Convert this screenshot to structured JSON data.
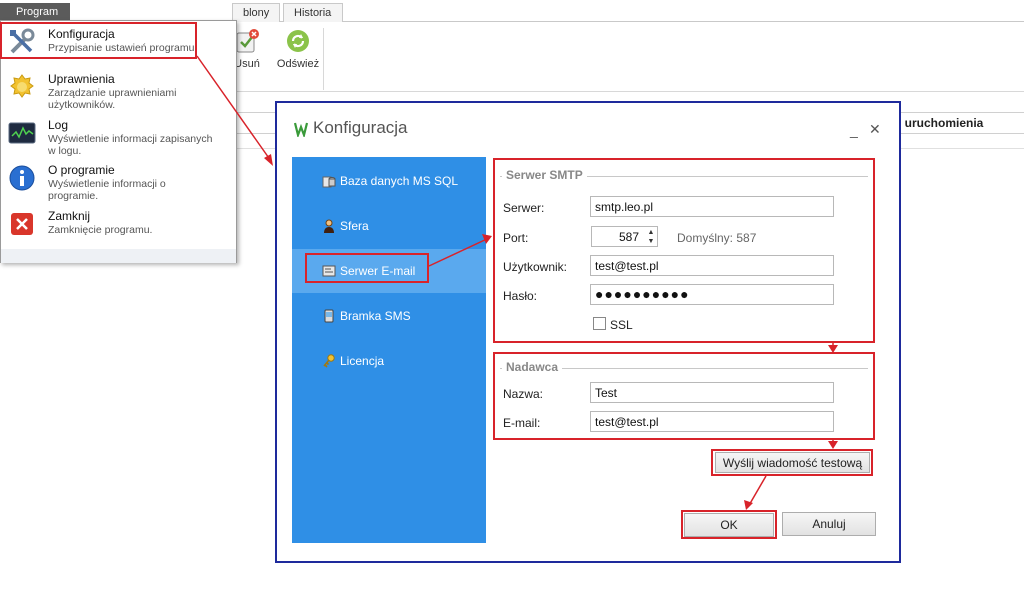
{
  "app": {
    "tabs": [
      {
        "label": "blony"
      },
      {
        "label": "Historia"
      }
    ],
    "ribbon": {
      "delete_label": "Usuń",
      "refresh_label": "Odśwież"
    },
    "grid": {
      "column_header": ". uruchomienia"
    }
  },
  "program_menu": {
    "button_label": "Program",
    "items": [
      {
        "title": "Konfiguracja",
        "desc": "Przypisanie ustawień programu.",
        "icon": "tools-icon"
      },
      {
        "title": "Uprawnienia",
        "desc": "Zarządzanie uprawnieniami użytkowników.",
        "icon": "badge-icon"
      },
      {
        "title": "Log",
        "desc": "Wyświetlenie informacji zapisanych w logu.",
        "icon": "log-icon"
      },
      {
        "title": "O programie",
        "desc": "Wyświetlenie informacji o programie.",
        "icon": "info-icon"
      },
      {
        "title": "Zamknij",
        "desc": "Zamknięcie programu.",
        "icon": "close-red-icon"
      }
    ]
  },
  "dialog": {
    "title": "Konfiguracja",
    "minimize": "_",
    "close": "✕",
    "sidebar": [
      {
        "label": "Baza danych MS SQL",
        "icon": "database-icon"
      },
      {
        "label": "Sfera",
        "icon": "user-icon"
      },
      {
        "label": "Serwer E-mail",
        "icon": "email-server-icon",
        "active": true
      },
      {
        "label": "Bramka SMS",
        "icon": "phone-icon"
      },
      {
        "label": "Licencja",
        "icon": "key-icon"
      }
    ],
    "smtp": {
      "legend": "Serwer SMTP",
      "server_label": "Serwer:",
      "server_value": "smtp.leo.pl",
      "port_label": "Port:",
      "port_value": "587",
      "port_default": "Domyślny: 587",
      "user_label": "Użytkownik:",
      "user_value": "test@test.pl",
      "password_label": "Hasło:",
      "password_value": "●●●●●●●●●●",
      "ssl_label": "SSL",
      "ssl_checked": false
    },
    "sender": {
      "legend": "Nadawca",
      "name_label": "Nazwa:",
      "name_value": "Test",
      "email_label": "E-mail:",
      "email_value": "test@test.pl"
    },
    "buttons": {
      "test_label": "Wyślij wiadomość testową",
      "ok_label": "OK",
      "cancel_label": "Anuluj"
    }
  },
  "colors": {
    "sidebar": "#2f8fe6",
    "sidebar_active": "#5aa9ee",
    "highlight": "#d8232a",
    "outer_frame": "#1e2a9c"
  }
}
